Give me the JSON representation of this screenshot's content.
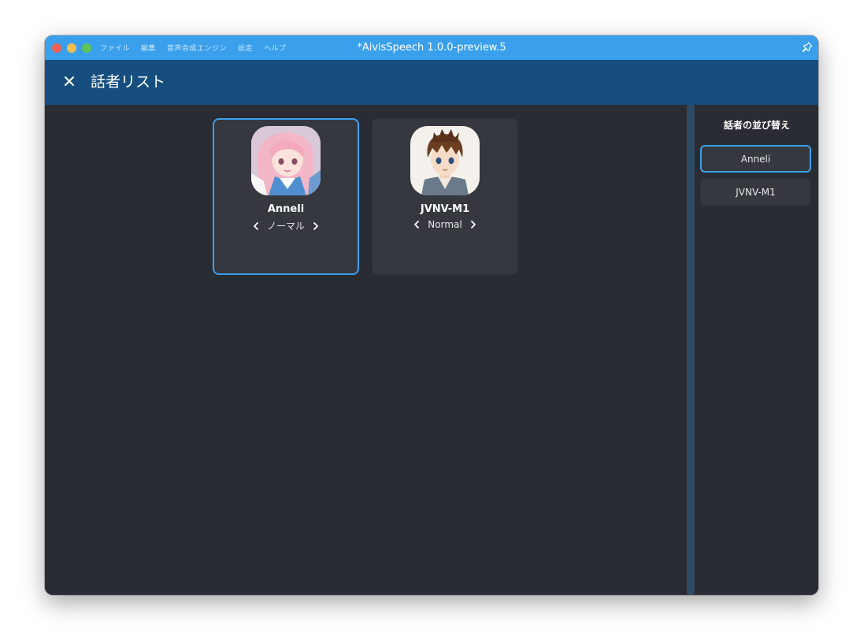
{
  "window": {
    "title": "*AivisSpeech 1.0.0-preview.5",
    "menu": [
      "ファイル",
      "編集",
      "音声合成エンジン",
      "設定",
      "ヘルプ"
    ]
  },
  "header": {
    "title": "話者リスト",
    "close_icon": "close-icon"
  },
  "speakers": [
    {
      "name": "Anneli",
      "style": "ノーマル",
      "selected": true
    },
    {
      "name": "JVNV-M1",
      "style": "Normal",
      "selected": false
    }
  ],
  "sidebar": {
    "title": "話者の並び替え",
    "items": [
      {
        "label": "Anneli",
        "selected": true
      },
      {
        "label": "JVNV-M1",
        "selected": false
      }
    ]
  },
  "colors": {
    "titlebar": "#3aa0ec",
    "header": "#164f7f",
    "background": "#2a2c33",
    "card": "#363840",
    "accent": "#3aa0ec"
  }
}
